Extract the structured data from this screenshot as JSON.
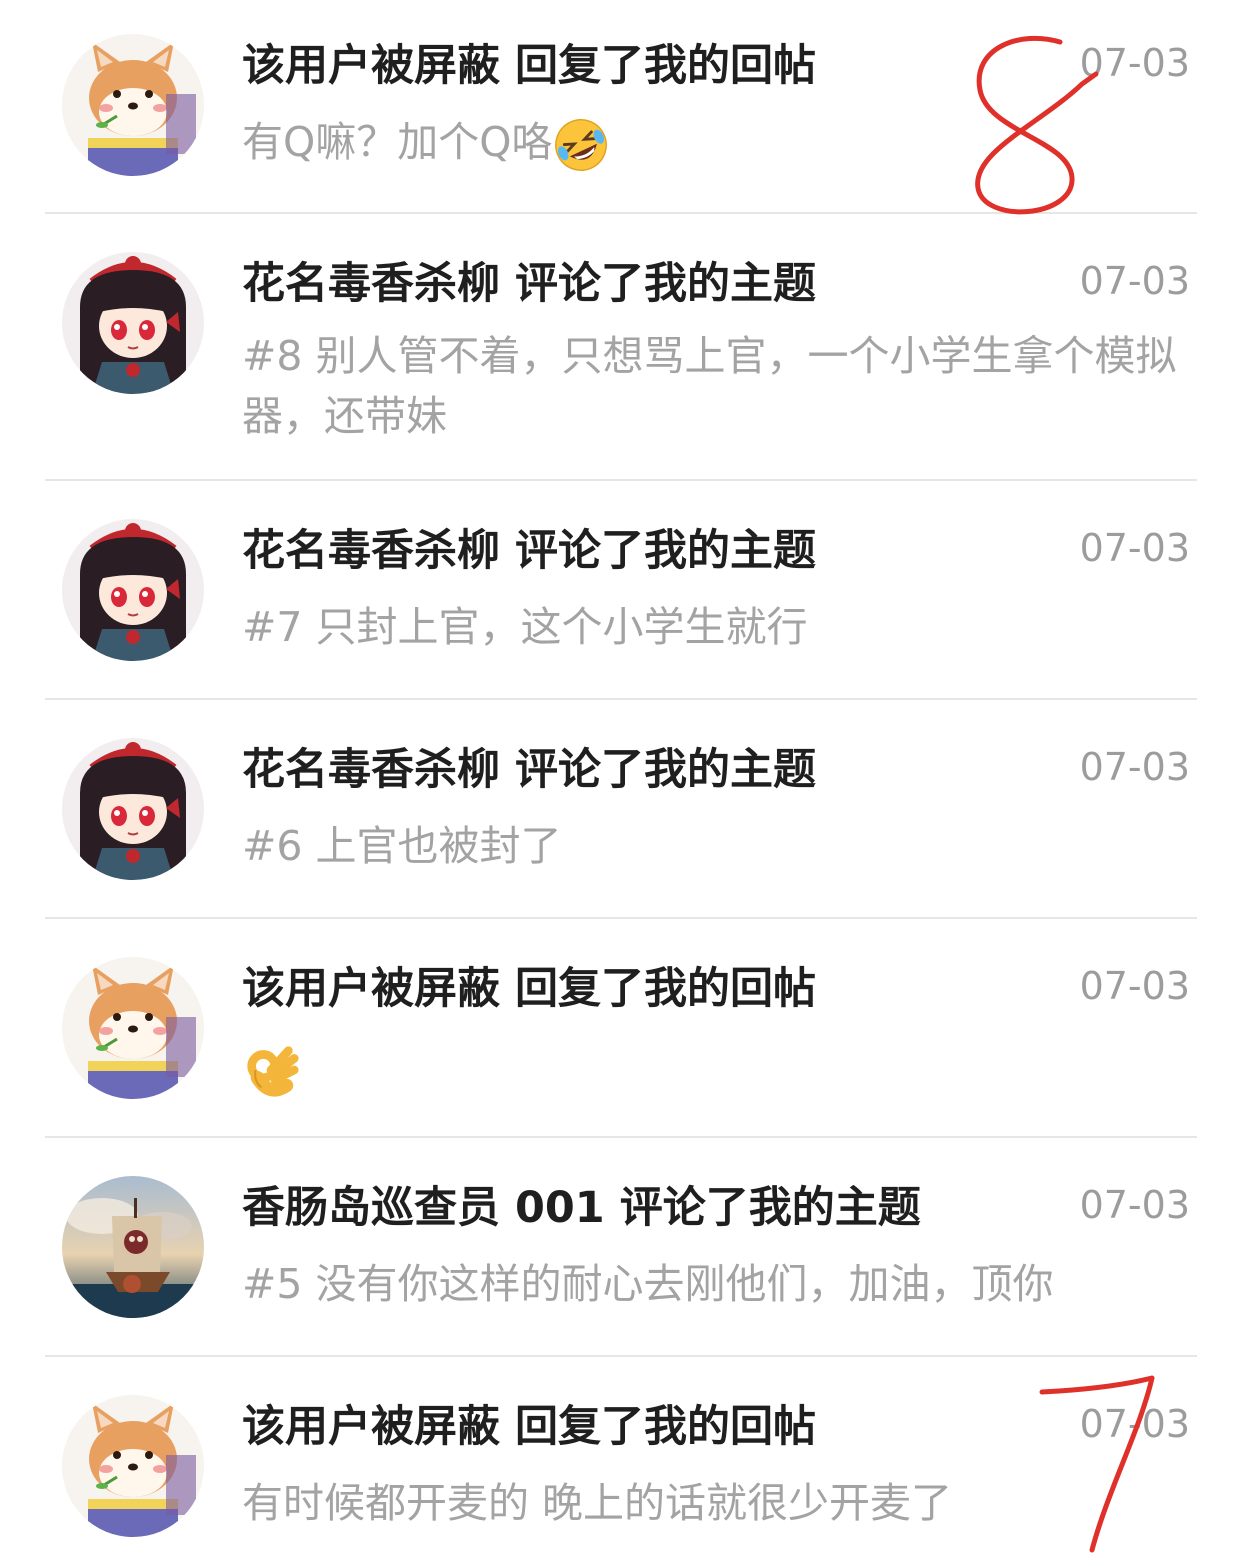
{
  "notifications": [
    {
      "avatar": "shiba-dog-avatar",
      "title": "该用户被屏蔽 回复了我的回帖",
      "date": "07-03",
      "body": "有Q嘛？加个Q咯",
      "emoji": "rolling-laughing-emoji"
    },
    {
      "avatar": "anime-girl-avatar",
      "title": "花名毒香杀柳 评论了我的主题",
      "date": "07-03",
      "body": "#8 别人管不着，只想骂上官，一个小学生拿个模拟器，还带妹"
    },
    {
      "avatar": "anime-girl-avatar",
      "title": "花名毒香杀柳 评论了我的主题",
      "date": "07-03",
      "body": "#7 只封上官，这个小学生就行"
    },
    {
      "avatar": "anime-girl-avatar",
      "title": "花名毒香杀柳 评论了我的主题",
      "date": "07-03",
      "body": "#6 上官也被封了"
    },
    {
      "avatar": "shiba-dog-avatar",
      "title": "该用户被屏蔽 回复了我的回帖",
      "date": "07-03",
      "body": "",
      "emoji": "ok-hand-emoji"
    },
    {
      "avatar": "pirate-ship-avatar",
      "title": "香肠岛巡查员 001 评论了我的主题",
      "date": "07-03",
      "body": "#5 没有你这样的耐心去刚他们，加油，顶你"
    },
    {
      "avatar": "shiba-dog-avatar",
      "title": "该用户被屏蔽 回复了我的回帖",
      "date": "07-03",
      "body": "有时候都开麦的  晚上的话就很少开麦了"
    }
  ],
  "annotations": {
    "mark_1": "8",
    "mark_2": "7",
    "color": "#e0302a"
  }
}
